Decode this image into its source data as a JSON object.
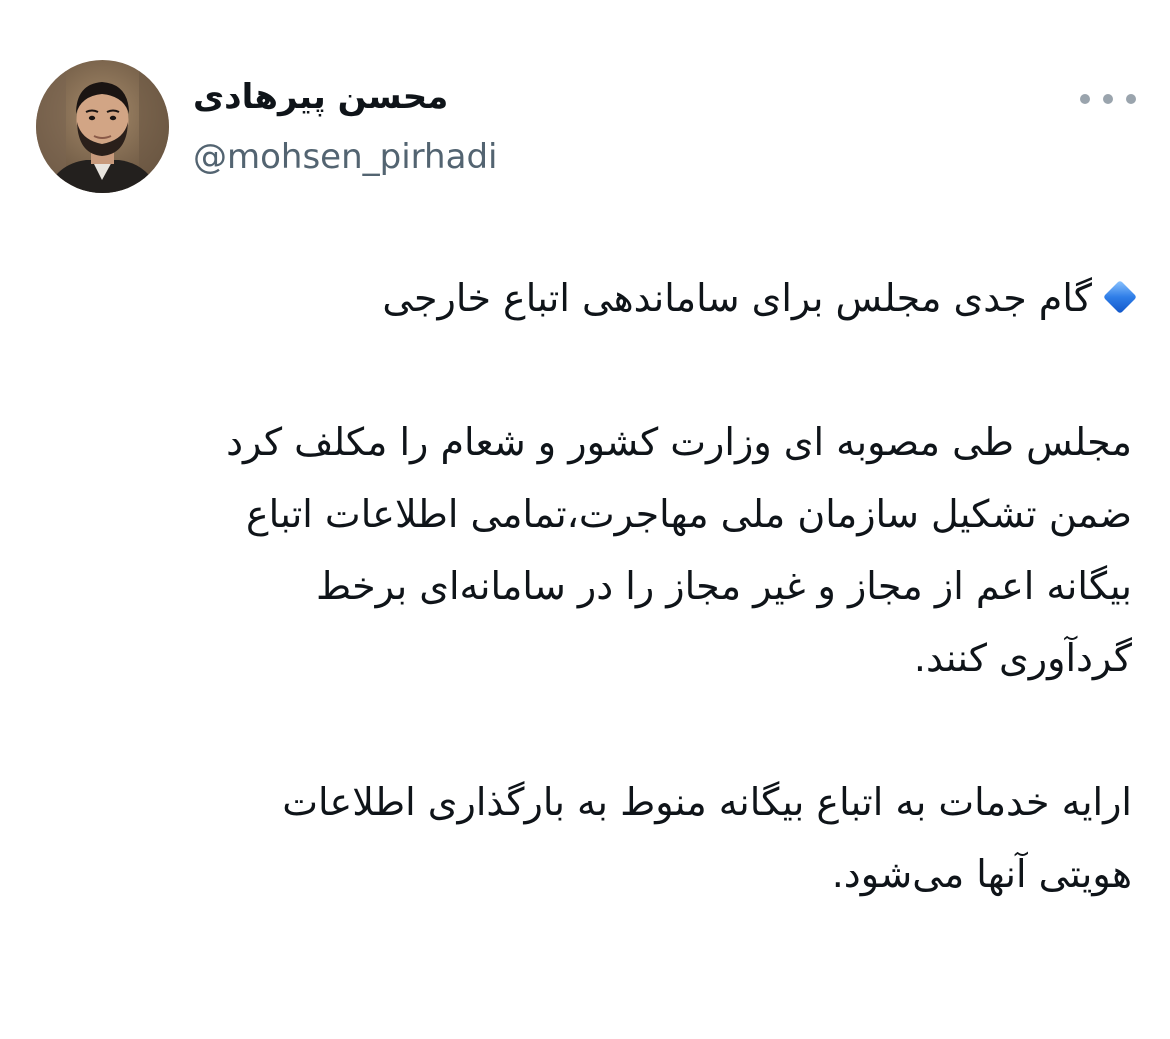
{
  "author": {
    "display_name": "محسن پیرهادی",
    "handle": "@mohsen_pirhadi",
    "avatar_icon": "profile-photo"
  },
  "more_icon": "more-dots-icon",
  "colors": {
    "text": "#0f1419",
    "secondary": "#536471",
    "diamond": "#2f7ee8"
  },
  "tweet": {
    "headline_icon": "blue-diamond-icon",
    "headline_lines": [
      "گام جدی مجلس برای ساماندهی اتباع خارجی"
    ],
    "paragraph1_lines": [
      "مجلس طی مصوبه ای وزارت کشور و شعام را  مکلف کرد",
      "ضمن تشکیل سازمان ملی مهاجرت،تمامی اطلاعات اتباع",
      "بیگانه اعم از مجاز و غیر مجاز را در سامانه‌ای برخط",
      "گردآوری کنند."
    ],
    "paragraph2_lines": [
      "ارایه خدمات به اتباع بیگانه منوط به بارگذاری  اطلاعات",
      "هویتی آنها می‌شود."
    ]
  }
}
